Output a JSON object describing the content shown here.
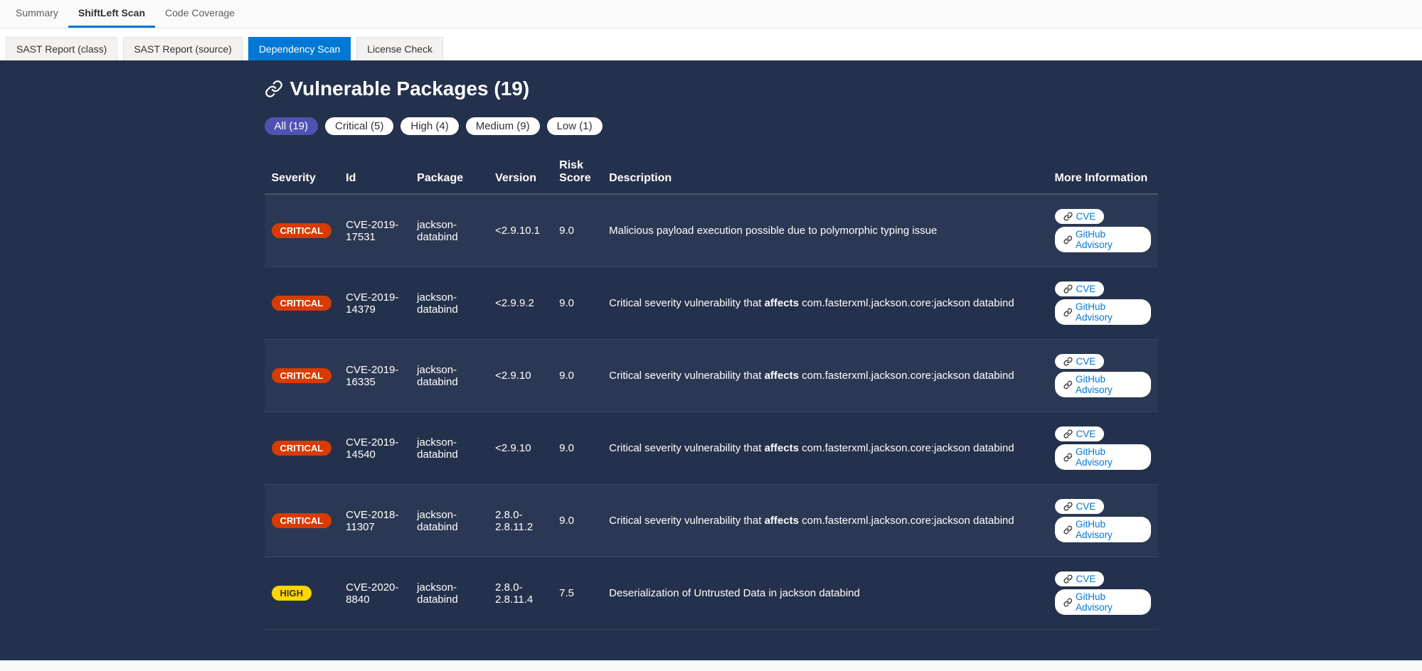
{
  "top_tabs": [
    {
      "label": "Summary",
      "active": false
    },
    {
      "label": "ShiftLeft Scan",
      "active": true
    },
    {
      "label": "Code Coverage",
      "active": false
    }
  ],
  "sub_tabs": [
    {
      "label": "SAST Report (class)",
      "active": false
    },
    {
      "label": "SAST Report (source)",
      "active": false
    },
    {
      "label": "Dependency Scan",
      "active": true
    },
    {
      "label": "License Check",
      "active": false
    }
  ],
  "heading": "Vulnerable Packages (19)",
  "filters": [
    {
      "label": "All (19)",
      "active": true
    },
    {
      "label": "Critical (5)",
      "active": false
    },
    {
      "label": "High (4)",
      "active": false
    },
    {
      "label": "Medium (9)",
      "active": false
    },
    {
      "label": "Low (1)",
      "active": false
    }
  ],
  "columns": {
    "severity": "Severity",
    "id": "Id",
    "package": "Package",
    "version": "Version",
    "risk": "Risk Score",
    "description": "Description",
    "more": "More Information"
  },
  "link_cve": "CVE",
  "link_gh": "GitHub Advisory",
  "rows": [
    {
      "severity": "CRITICAL",
      "sev_class": "critical",
      "id": "CVE-2019-17531",
      "package": "jackson-databind",
      "version": "<2.9.10.1",
      "risk": "9.0",
      "desc_pre": "Malicious payload execution possible due to polymorphic typing issue",
      "desc_bold": "",
      "desc_post": ""
    },
    {
      "severity": "CRITICAL",
      "sev_class": "critical",
      "id": "CVE-2019-14379",
      "package": "jackson-databind",
      "version": "<2.9.9.2",
      "risk": "9.0",
      "desc_pre": "Critical severity vulnerability that ",
      "desc_bold": "affects",
      "desc_post": " com.fasterxml.jackson.core:jackson databind"
    },
    {
      "severity": "CRITICAL",
      "sev_class": "critical",
      "id": "CVE-2019-16335",
      "package": "jackson-databind",
      "version": "<2.9.10",
      "risk": "9.0",
      "desc_pre": "Critical severity vulnerability that ",
      "desc_bold": "affects",
      "desc_post": " com.fasterxml.jackson.core:jackson databind"
    },
    {
      "severity": "CRITICAL",
      "sev_class": "critical",
      "id": "CVE-2019-14540",
      "package": "jackson-databind",
      "version": "<2.9.10",
      "risk": "9.0",
      "desc_pre": "Critical severity vulnerability that ",
      "desc_bold": "affects",
      "desc_post": " com.fasterxml.jackson.core:jackson databind"
    },
    {
      "severity": "CRITICAL",
      "sev_class": "critical",
      "id": "CVE-2018-11307",
      "package": "jackson-databind",
      "version": "2.8.0-2.8.11.2",
      "risk": "9.0",
      "desc_pre": "Critical severity vulnerability that ",
      "desc_bold": "affects",
      "desc_post": " com.fasterxml.jackson.core:jackson databind"
    },
    {
      "severity": "HIGH",
      "sev_class": "high",
      "id": "CVE-2020-8840",
      "package": "jackson-databind",
      "version": "2.8.0-2.8.11.4",
      "risk": "7.5",
      "desc_pre": "Deserialization of Untrusted Data in jackson databind",
      "desc_bold": "",
      "desc_post": ""
    }
  ]
}
